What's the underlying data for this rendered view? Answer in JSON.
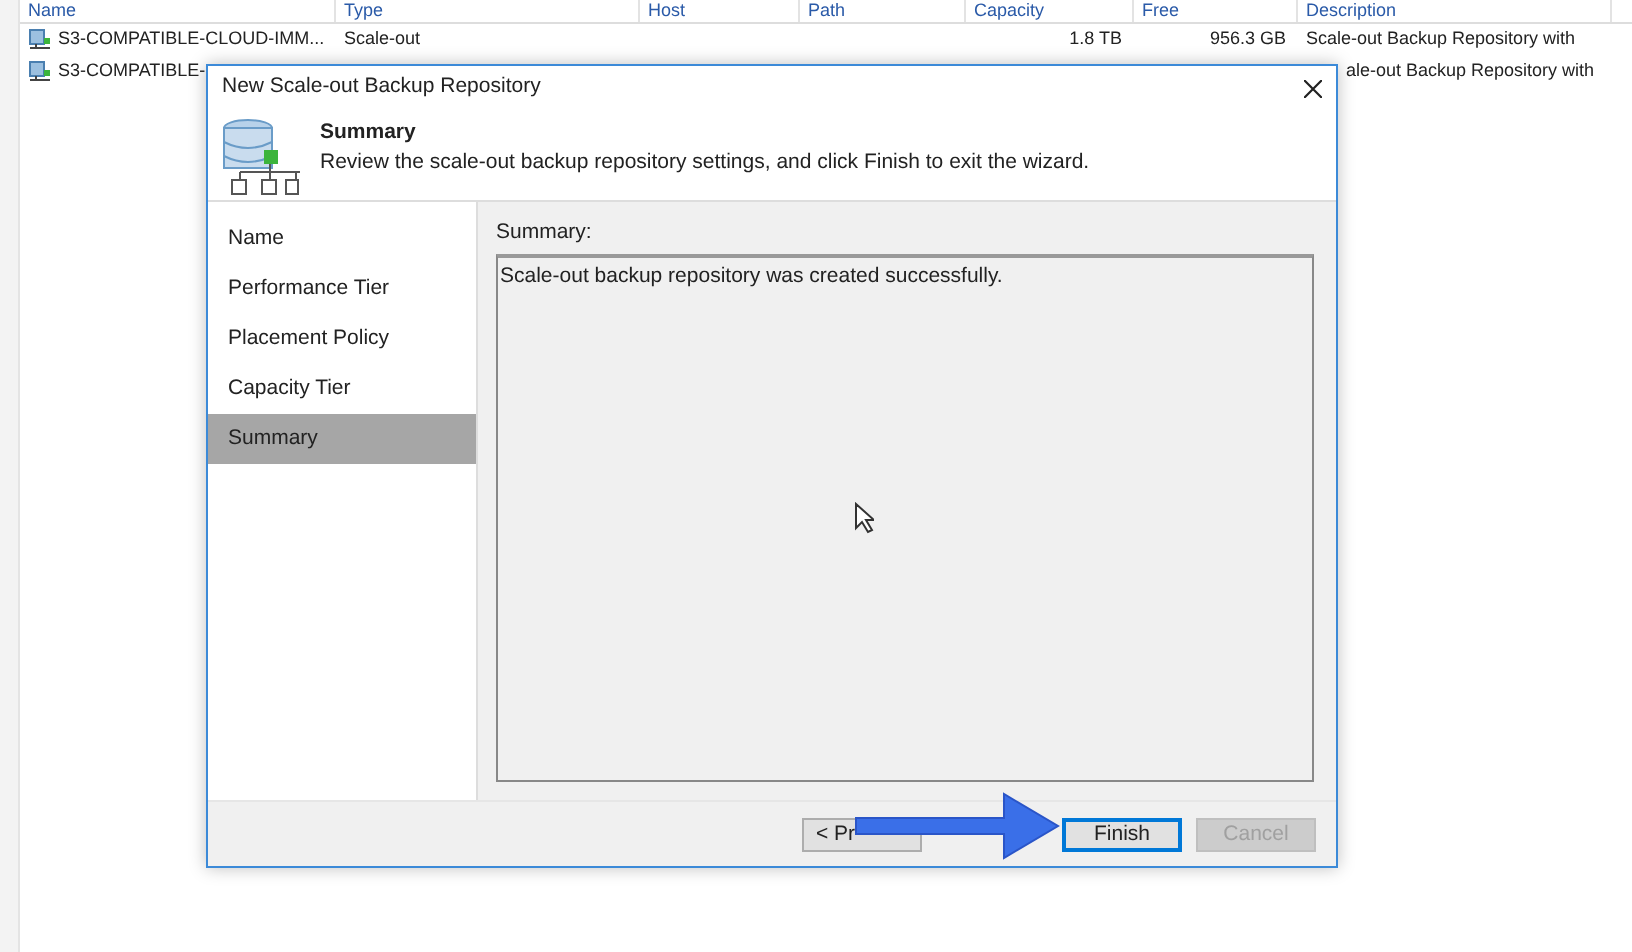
{
  "table": {
    "columns": [
      "Name",
      "Type",
      "Host",
      "Path",
      "Capacity",
      "Free",
      "Description"
    ],
    "rows": [
      {
        "cells": [
          "S3-COMPATIBLE-CLOUD-IMM...",
          "Scale-out",
          "",
          "",
          "1.8 TB",
          "956.3 GB",
          "Scale-out Backup Repository with"
        ],
        "selected": false
      },
      {
        "cells": [
          "S3-COMPATIBLE-",
          "",
          "",
          "",
          "",
          "",
          "ale-out Backup Repository with"
        ],
        "selected": false
      }
    ]
  },
  "dialog": {
    "title": "New Scale-out Backup Repository",
    "heading": "Summary",
    "subtitle": "Review the scale-out backup repository settings, and click Finish to exit the wizard.",
    "steps": [
      {
        "label": "Name",
        "selected": false
      },
      {
        "label": "Performance Tier",
        "selected": false
      },
      {
        "label": "Placement Policy",
        "selected": false
      },
      {
        "label": "Capacity Tier",
        "selected": false
      },
      {
        "label": "Summary",
        "selected": true
      }
    ],
    "summary_label": "Summary:",
    "summary_text": "Scale-out backup repository was created successfully.",
    "buttons": [
      {
        "label": "< Pr",
        "disabled": false,
        "focused": false
      },
      {
        "label": "Finish",
        "disabled": false,
        "focused": true
      },
      {
        "label": "Cancel",
        "disabled": true,
        "focused": false
      }
    ]
  }
}
